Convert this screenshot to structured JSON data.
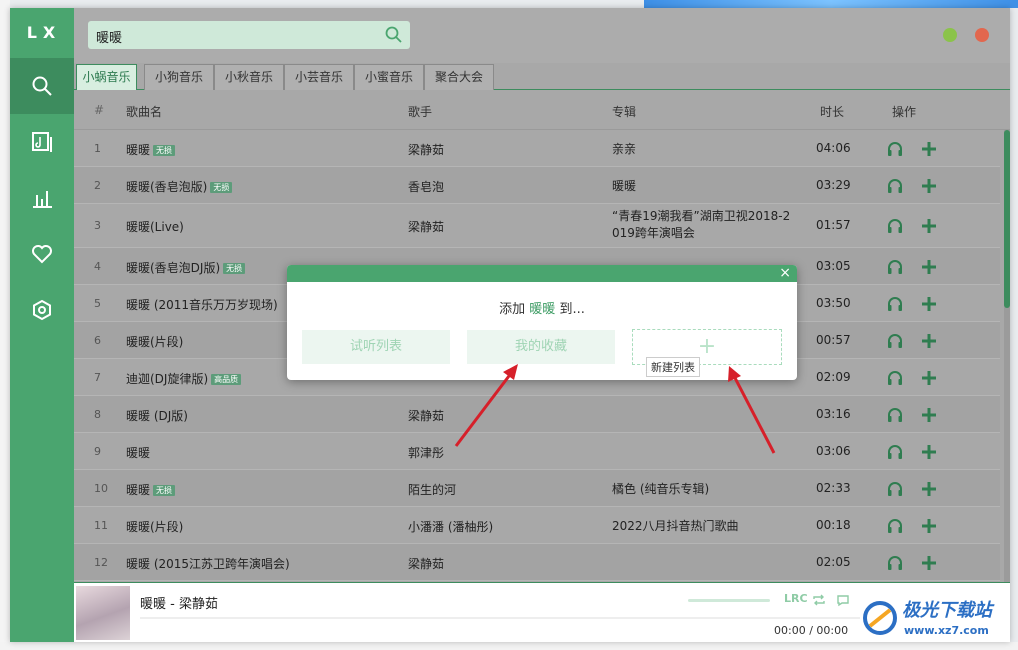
{
  "app": {
    "logo": "LX"
  },
  "sidebar": {
    "items": [
      {
        "name": "search-icon"
      },
      {
        "name": "music-file-icon"
      },
      {
        "name": "chart-icon"
      },
      {
        "name": "heart-icon"
      },
      {
        "name": "settings-icon"
      }
    ]
  },
  "search": {
    "value": "暖暖"
  },
  "colors": {
    "accent": "#4aa56f",
    "min": "#8bc34a",
    "close": "#e2674e"
  },
  "tabs": [
    "小蜗音乐",
    "小狗音乐",
    "小秋音乐",
    "小芸音乐",
    "小蜜音乐",
    "聚合大会"
  ],
  "table": {
    "headers": {
      "index": "#",
      "song": "歌曲名",
      "singer": "歌手",
      "album": "专辑",
      "duration": "时长",
      "ops": "操作"
    },
    "rows": [
      {
        "no": "1",
        "song": "暖暖",
        "badge": "无损",
        "singer": "梁静茹",
        "album": "亲亲",
        "album2": "",
        "time": "04:06"
      },
      {
        "no": "2",
        "song": "暖暖(香皂泡版)",
        "badge": "无损",
        "singer": "香皂泡",
        "album": "暖暖",
        "album2": "",
        "time": "03:29"
      },
      {
        "no": "3",
        "song": "暖暖(Live)",
        "badge": "",
        "singer": "梁静茹",
        "album": "“青春19潮我看”湖南卫视2018-2",
        "album2": "019跨年演唱会",
        "time": "01:57"
      },
      {
        "no": "4",
        "song": "暖暖(香皂泡DJ版)",
        "badge": "无损",
        "singer": "",
        "album": "",
        "album2": "",
        "time": "03:05"
      },
      {
        "no": "5",
        "song": "暖暖 (2011音乐万万岁现场)",
        "badge": "",
        "singer": "",
        "album": "",
        "album2": "",
        "time": "03:50"
      },
      {
        "no": "6",
        "song": "暖暖(片段)",
        "badge": "",
        "singer": "",
        "album": "",
        "album2": "",
        "time": "00:57"
      },
      {
        "no": "7",
        "song": "迪迦(DJ旋律版)",
        "badge": "高品质",
        "singer": "",
        "album": "",
        "album2": "",
        "time": "02:09"
      },
      {
        "no": "8",
        "song": "暖暖 (DJ版)",
        "badge": "",
        "singer": "梁静茹",
        "album": "",
        "album2": "",
        "time": "03:16"
      },
      {
        "no": "9",
        "song": "暖暖",
        "badge": "",
        "singer": "郭津彤",
        "album": "",
        "album2": "",
        "time": "03:06"
      },
      {
        "no": "10",
        "song": "暖暖",
        "badge": "无损",
        "singer": "陌生的河",
        "album": "橘色 (纯音乐专辑)",
        "album2": "",
        "time": "02:33"
      },
      {
        "no": "11",
        "song": "暖暖(片段)",
        "badge": "",
        "singer": "小潘潘 (潘柚彤)",
        "album": "2022八月抖音热门歌曲",
        "album2": "",
        "time": "00:18"
      },
      {
        "no": "12",
        "song": "暖暖 (2015江苏卫跨年演唱会)",
        "badge": "",
        "singer": "梁静茹",
        "album": "",
        "album2": "",
        "time": "02:05"
      }
    ]
  },
  "player": {
    "title": "暖暖 - 梁静茹",
    "current": "00:00",
    "separator": "/",
    "total": "00:00",
    "lrc": "LRC"
  },
  "dialog": {
    "prefix": "添加",
    "song": "暖暖",
    "suffix": "到...",
    "btn_trial": "试听列表",
    "btn_fav": "我的收藏",
    "new_tooltip": "新建列表",
    "close": "×"
  },
  "watermark": {
    "text": "极光下载站",
    "url": "www.xz7.com"
  }
}
